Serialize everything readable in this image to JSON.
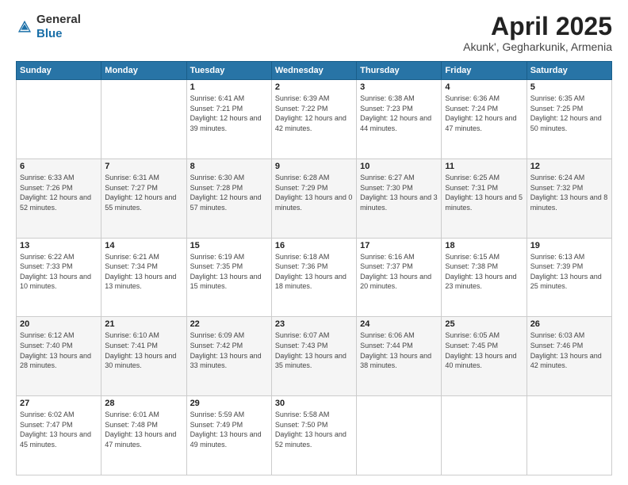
{
  "header": {
    "logo_general": "General",
    "logo_blue": "Blue",
    "title": "April 2025",
    "location": "Akunk', Gegharkunik, Armenia"
  },
  "days_of_week": [
    "Sunday",
    "Monday",
    "Tuesday",
    "Wednesday",
    "Thursday",
    "Friday",
    "Saturday"
  ],
  "weeks": [
    [
      {
        "num": "",
        "info": ""
      },
      {
        "num": "",
        "info": ""
      },
      {
        "num": "1",
        "info": "Sunrise: 6:41 AM\nSunset: 7:21 PM\nDaylight: 12 hours and 39 minutes."
      },
      {
        "num": "2",
        "info": "Sunrise: 6:39 AM\nSunset: 7:22 PM\nDaylight: 12 hours and 42 minutes."
      },
      {
        "num": "3",
        "info": "Sunrise: 6:38 AM\nSunset: 7:23 PM\nDaylight: 12 hours and 44 minutes."
      },
      {
        "num": "4",
        "info": "Sunrise: 6:36 AM\nSunset: 7:24 PM\nDaylight: 12 hours and 47 minutes."
      },
      {
        "num": "5",
        "info": "Sunrise: 6:35 AM\nSunset: 7:25 PM\nDaylight: 12 hours and 50 minutes."
      }
    ],
    [
      {
        "num": "6",
        "info": "Sunrise: 6:33 AM\nSunset: 7:26 PM\nDaylight: 12 hours and 52 minutes."
      },
      {
        "num": "7",
        "info": "Sunrise: 6:31 AM\nSunset: 7:27 PM\nDaylight: 12 hours and 55 minutes."
      },
      {
        "num": "8",
        "info": "Sunrise: 6:30 AM\nSunset: 7:28 PM\nDaylight: 12 hours and 57 minutes."
      },
      {
        "num": "9",
        "info": "Sunrise: 6:28 AM\nSunset: 7:29 PM\nDaylight: 13 hours and 0 minutes."
      },
      {
        "num": "10",
        "info": "Sunrise: 6:27 AM\nSunset: 7:30 PM\nDaylight: 13 hours and 3 minutes."
      },
      {
        "num": "11",
        "info": "Sunrise: 6:25 AM\nSunset: 7:31 PM\nDaylight: 13 hours and 5 minutes."
      },
      {
        "num": "12",
        "info": "Sunrise: 6:24 AM\nSunset: 7:32 PM\nDaylight: 13 hours and 8 minutes."
      }
    ],
    [
      {
        "num": "13",
        "info": "Sunrise: 6:22 AM\nSunset: 7:33 PM\nDaylight: 13 hours and 10 minutes."
      },
      {
        "num": "14",
        "info": "Sunrise: 6:21 AM\nSunset: 7:34 PM\nDaylight: 13 hours and 13 minutes."
      },
      {
        "num": "15",
        "info": "Sunrise: 6:19 AM\nSunset: 7:35 PM\nDaylight: 13 hours and 15 minutes."
      },
      {
        "num": "16",
        "info": "Sunrise: 6:18 AM\nSunset: 7:36 PM\nDaylight: 13 hours and 18 minutes."
      },
      {
        "num": "17",
        "info": "Sunrise: 6:16 AM\nSunset: 7:37 PM\nDaylight: 13 hours and 20 minutes."
      },
      {
        "num": "18",
        "info": "Sunrise: 6:15 AM\nSunset: 7:38 PM\nDaylight: 13 hours and 23 minutes."
      },
      {
        "num": "19",
        "info": "Sunrise: 6:13 AM\nSunset: 7:39 PM\nDaylight: 13 hours and 25 minutes."
      }
    ],
    [
      {
        "num": "20",
        "info": "Sunrise: 6:12 AM\nSunset: 7:40 PM\nDaylight: 13 hours and 28 minutes."
      },
      {
        "num": "21",
        "info": "Sunrise: 6:10 AM\nSunset: 7:41 PM\nDaylight: 13 hours and 30 minutes."
      },
      {
        "num": "22",
        "info": "Sunrise: 6:09 AM\nSunset: 7:42 PM\nDaylight: 13 hours and 33 minutes."
      },
      {
        "num": "23",
        "info": "Sunrise: 6:07 AM\nSunset: 7:43 PM\nDaylight: 13 hours and 35 minutes."
      },
      {
        "num": "24",
        "info": "Sunrise: 6:06 AM\nSunset: 7:44 PM\nDaylight: 13 hours and 38 minutes."
      },
      {
        "num": "25",
        "info": "Sunrise: 6:05 AM\nSunset: 7:45 PM\nDaylight: 13 hours and 40 minutes."
      },
      {
        "num": "26",
        "info": "Sunrise: 6:03 AM\nSunset: 7:46 PM\nDaylight: 13 hours and 42 minutes."
      }
    ],
    [
      {
        "num": "27",
        "info": "Sunrise: 6:02 AM\nSunset: 7:47 PM\nDaylight: 13 hours and 45 minutes."
      },
      {
        "num": "28",
        "info": "Sunrise: 6:01 AM\nSunset: 7:48 PM\nDaylight: 13 hours and 47 minutes."
      },
      {
        "num": "29",
        "info": "Sunrise: 5:59 AM\nSunset: 7:49 PM\nDaylight: 13 hours and 49 minutes."
      },
      {
        "num": "30",
        "info": "Sunrise: 5:58 AM\nSunset: 7:50 PM\nDaylight: 13 hours and 52 minutes."
      },
      {
        "num": "",
        "info": ""
      },
      {
        "num": "",
        "info": ""
      },
      {
        "num": "",
        "info": ""
      }
    ]
  ]
}
